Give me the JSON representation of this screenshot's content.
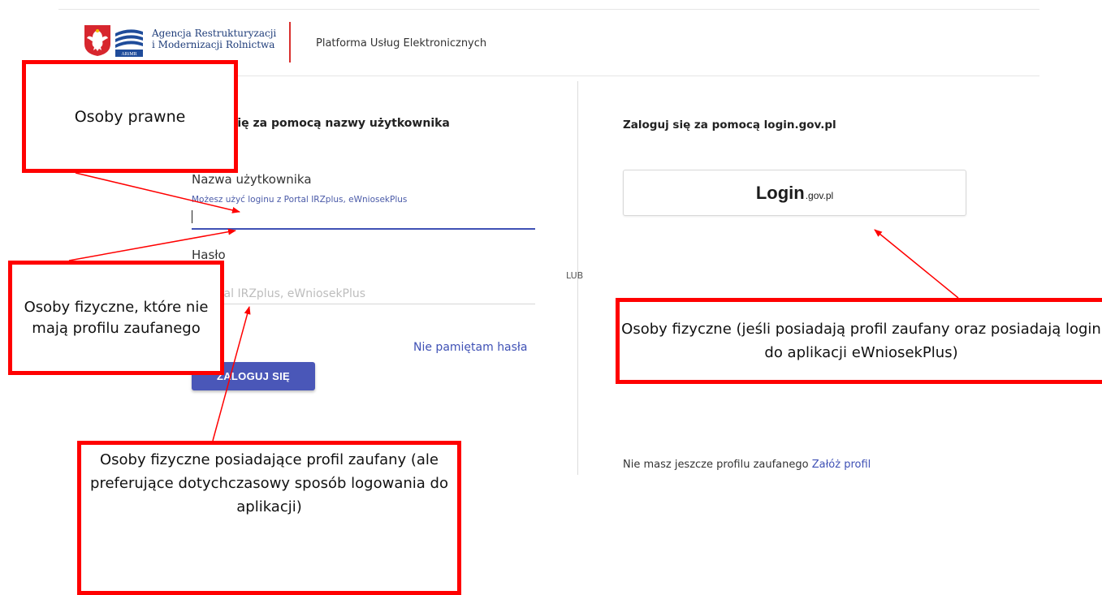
{
  "header": {
    "agency_line1": "Agencja Restrukturyzacji",
    "agency_line2": "i Modernizacji Rolnictwa",
    "logo_text": "ARiMR",
    "platform": "Platforma Usług Elektronicznych"
  },
  "left": {
    "title": "się za pomocą nazwy użytkownika",
    "username_label": "Nazwa użytkownika",
    "username_hint": "Możesz użyć loginu z Portal IRZplus, eWniosekPlus",
    "username_value": "",
    "password_label": "Hasło",
    "password_placeholder": "z Portal IRZplus, eWniosekPlus",
    "forgot": "Nie pamiętam hasła",
    "login_button": "ZALOGUJ SIĘ"
  },
  "divider": {
    "or": "LUB"
  },
  "right": {
    "title": "Zaloguj się za pomocą login.gov.pl",
    "gov_main": "Login",
    "gov_suffix": ".gov.pl",
    "no_profile": "Nie masz jeszcze profilu zaufanego",
    "create_profile": "Załóż profil"
  },
  "annotations": {
    "legal": "Osoby prawne",
    "natural_no_profile": "Osoby fizyczne, które nie mają profilu zaufanego",
    "natural_profile_pref": "Osoby fizyczne posiadające profil zaufany (ale preferujące dotychczasowy sposób logowania do aplikacji)",
    "natural_profile_login": "Osoby fizyczne (jeśli posiadają profil zaufany oraz posiadają login do aplikacji eWniosekPlus)"
  },
  "colors": {
    "accent": "#3f51b5",
    "callout_border": "#ff0000",
    "brand_red": "#d9302e"
  }
}
